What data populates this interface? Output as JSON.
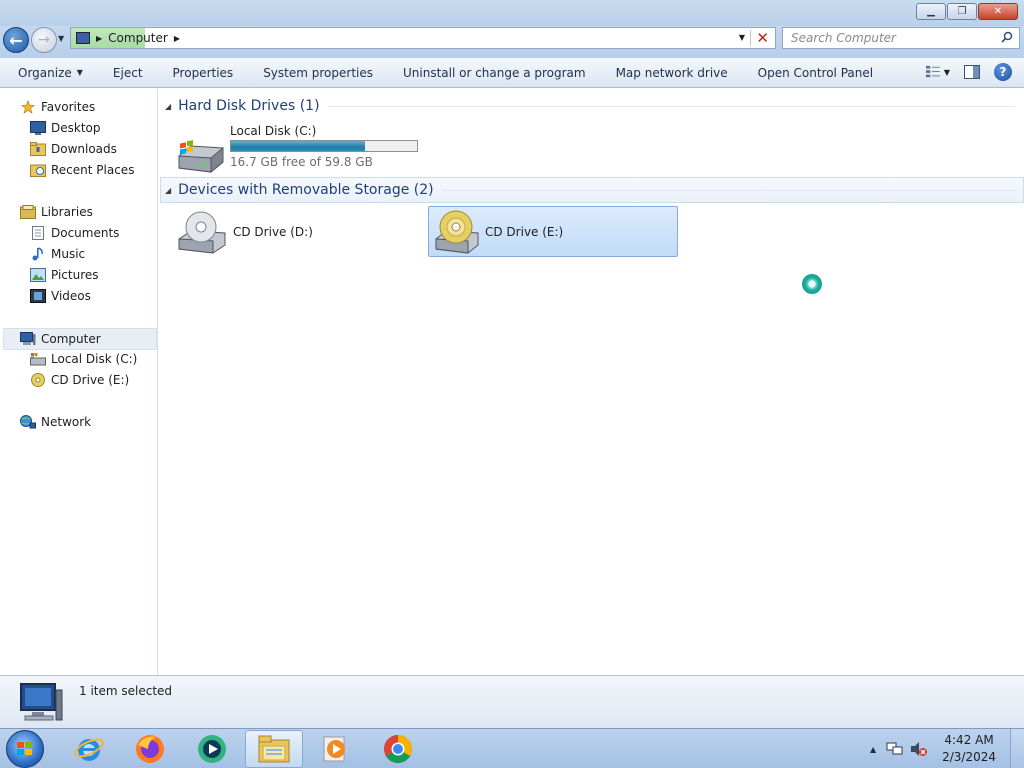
{
  "window": {
    "minimize_glyph": "▁",
    "maximize_glyph": "❐",
    "close_glyph": "✕"
  },
  "navbar": {
    "address_location": "Computer",
    "search_placeholder": "Search Computer"
  },
  "toolbar": {
    "organize": "Organize",
    "eject": "Eject",
    "properties": "Properties",
    "system_properties": "System properties",
    "uninstall": "Uninstall or change a program",
    "map_network_drive": "Map network drive",
    "open_control_panel": "Open Control Panel",
    "help_glyph": "?"
  },
  "navpane": {
    "favorites": "Favorites",
    "desktop": "Desktop",
    "downloads": "Downloads",
    "recent_places": "Recent Places",
    "libraries": "Libraries",
    "documents": "Documents",
    "music": "Music",
    "pictures": "Pictures",
    "videos": "Videos",
    "computer": "Computer",
    "local_disk": "Local Disk (C:)",
    "cd_drive_e": "CD Drive (E:)",
    "network": "Network"
  },
  "content": {
    "hdd_group": "Hard Disk Drives (1)",
    "local_disk_label": "Local Disk (C:)",
    "local_disk_free": "16.7 GB free of 59.8 GB",
    "local_disk_used_fraction": 0.72,
    "removable_group": "Devices with Removable Storage (2)",
    "cd_drive_d": "CD Drive (D:)",
    "cd_drive_e": "CD Drive (E:)"
  },
  "details": {
    "status": "1 item selected"
  },
  "taskbar": {
    "time": "4:42 AM",
    "date": "2/3/2024"
  }
}
